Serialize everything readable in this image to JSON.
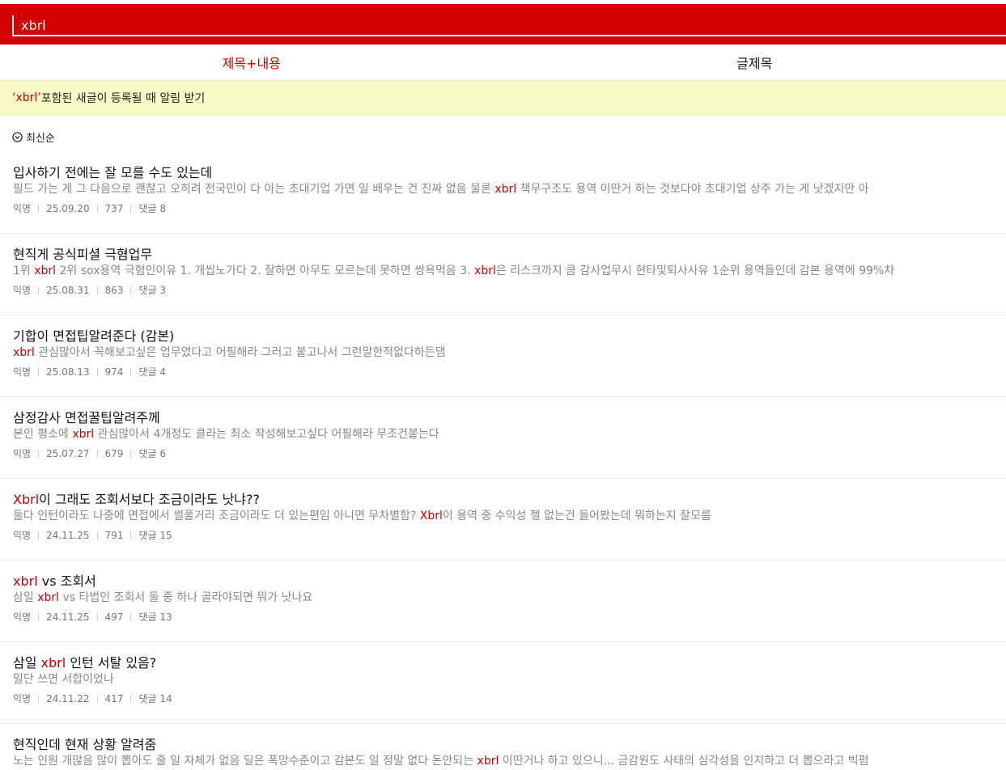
{
  "search": {
    "value": "xbrl"
  },
  "tabs": [
    {
      "label": "제목+내용",
      "active": true
    },
    {
      "label": "글제목",
      "active": false
    }
  ],
  "alert": {
    "keyword": "‘xbrl’",
    "text": " 포함된 새글이 등록될 때 알림 받기"
  },
  "sort": {
    "label": "최신순",
    "icon": "chevron-down-circle-icon"
  },
  "accent_color": "#c40000",
  "posts": [
    {
      "title": [
        {
          "t": "입사하기 전에는 잘 모를 수도 있는데"
        }
      ],
      "body": [
        {
          "t": "필드 가는 게 그 다음으로 괜찮고 오히려 전국민이 다 아는 초대기업 가면 일 배우는 건 진짜 없음 물론 "
        },
        {
          "t": "xbrl",
          "hl": true
        },
        {
          "t": " 책무구조도 용역 이딴거 하는 것보다야 초대기업 상주 가는 게 낫겠지만 아"
        }
      ],
      "author": "익명",
      "date": "25.09.20",
      "views": "737",
      "comments": "댓글 8"
    },
    {
      "title": [
        {
          "t": "현직게 공식피셜 극혐업무"
        }
      ],
      "body": [
        {
          "t": "1위 "
        },
        {
          "t": "xbrl",
          "hl": true
        },
        {
          "t": " 2위 sox용역 극혐인이유 1. 개씹노가다 2. 잘하면 아무도 모르는데 못하면 쌍욕먹음 3. "
        },
        {
          "t": "xbrl",
          "hl": true
        },
        {
          "t": "은 리스크까지 큼 감사업무시 현타및퇴사사유 1순위 용역들인데 감본 용역에 99%차"
        }
      ],
      "author": "익명",
      "date": "25.08.31",
      "views": "863",
      "comments": "댓글 3"
    },
    {
      "title": [
        {
          "t": "기합이 면접팁알려준다 (감본)"
        }
      ],
      "body": [
        {
          "t": "xbrl",
          "hl": true
        },
        {
          "t": " 관심많아서 꼭해보고싶은 업무였다고 어필해라 그러고 붙고나서 그런말한적없다하든댐"
        }
      ],
      "author": "익명",
      "date": "25.08.13",
      "views": "974",
      "comments": "댓글 4"
    },
    {
      "title": [
        {
          "t": "삼정감사 면접꿀팁알려주께"
        }
      ],
      "body": [
        {
          "t": "본인 평소에 "
        },
        {
          "t": "xbrl",
          "hl": true
        },
        {
          "t": " 관심많아서 4개정도 클라는 최소 작성해보고싶다 어필해라 무조건붙는다"
        }
      ],
      "author": "익명",
      "date": "25.07.27",
      "views": "679",
      "comments": "댓글 6"
    },
    {
      "title": [
        {
          "t": "Xbrl",
          "hl": true
        },
        {
          "t": "이 그래도 조회서보다 조금이라도 낫냐??"
        }
      ],
      "body": [
        {
          "t": "둘다 인턴이라도 나중에 면접에서 썰풀거리 조금이라도 더 있는편임 아니면 무차별함? "
        },
        {
          "t": "Xbrl",
          "hl": true
        },
        {
          "t": "이 용역 중 수익성 젤 없는건 들어봤는데 뭐하는지 잘모름"
        }
      ],
      "author": "익명",
      "date": "24.11.25",
      "views": "791",
      "comments": "댓글 15"
    },
    {
      "title": [
        {
          "t": "xbrl",
          "hl": true
        },
        {
          "t": " vs 조회서"
        }
      ],
      "body": [
        {
          "t": "삼일 "
        },
        {
          "t": "xbrl",
          "hl": true
        },
        {
          "t": " vs 타법인 조회서 둘 중 하나 골라야되면 뭐가 낫나요"
        }
      ],
      "author": "익명",
      "date": "24.11.25",
      "views": "497",
      "comments": "댓글 13"
    },
    {
      "title": [
        {
          "t": "삼일 "
        },
        {
          "t": "xbrl",
          "hl": true
        },
        {
          "t": " 인턴 서탈 있음?"
        }
      ],
      "body": [
        {
          "t": "일단 쓰면 서합이었나"
        }
      ],
      "author": "익명",
      "date": "24.11.22",
      "views": "417",
      "comments": "댓글 14"
    },
    {
      "title": [
        {
          "t": "현직인데 현재 상황 알려줌"
        }
      ],
      "body": [
        {
          "t": "노는 인원 개많음 많이 뽑아도 줄 일 자체가 없음 딜은 폭망수준이고 감본도 일 정말 없다 돈안되는 "
        },
        {
          "t": "xbrl",
          "hl": true
        },
        {
          "t": " 이딴거나 하고 있으니... 금감원도 사태의 심각성을 인지하고 더 뽑으라고 빅펌"
        }
      ],
      "author": "익명",
      "date": "",
      "views": "",
      "comments": ""
    }
  ]
}
